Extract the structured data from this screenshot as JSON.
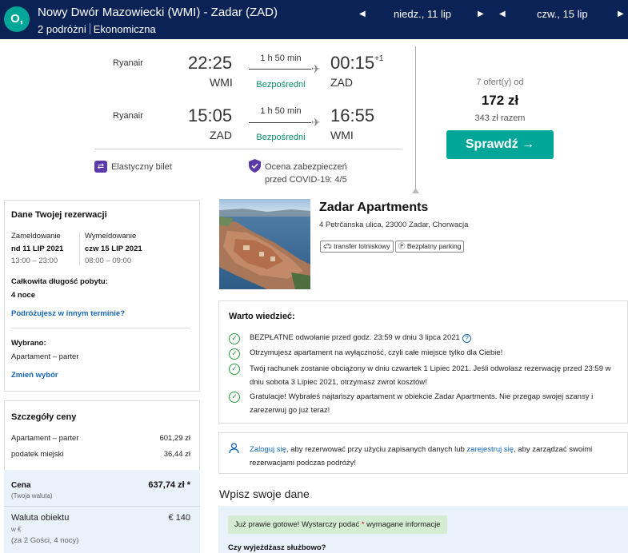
{
  "header": {
    "logo_char": "O,",
    "route": "Nowy Dwór Mazowiecki (WMI) - Zadar (ZAD)",
    "travelers": "2 podróżni",
    "cabin": "Ekonomiczna",
    "date_out": "niedz., 11 lip",
    "date_back": "czw., 15 lip"
  },
  "flights": [
    {
      "carrier": "Ryanair",
      "dep_time": "22:25",
      "dep_ap": "WMI",
      "duration": "1 h 50 min",
      "stops": "Bezpośredni",
      "arr_time": "00:15",
      "arr_extra": "+1",
      "arr_ap": "ZAD"
    },
    {
      "carrier": "Ryanair",
      "dep_time": "15:05",
      "dep_ap": "ZAD",
      "duration": "1 h 50 min",
      "stops": "Bezpośredni",
      "arr_time": "16:55",
      "arr_extra": "",
      "arr_ap": "WMI"
    }
  ],
  "features": {
    "flex": "Elastyczny bilet",
    "covid_1": "Ocena zabezpieczeń",
    "covid_2": "przed COVID-19: 4/5"
  },
  "deal": {
    "offers": "7 ofert(y) od",
    "price": "172 zł",
    "total": "343 zł razem",
    "button": "Sprawdź →"
  },
  "reservation": {
    "title": "Dane Twojej rezerwacji",
    "checkin_label": "Zameldowanie",
    "checkin_date": "nd 11 LIP 2021",
    "checkin_time": "13:00 – 23:00",
    "checkout_label": "Wymeldowanie",
    "checkout_date": "czw 15 LIP 2021",
    "checkout_time": "08:00 – 09:00",
    "stay_label": "Całkowita długość pobytu:",
    "stay_value": "4 noce",
    "change_dates": "Podróżujesz w innym terminie?",
    "selected_label": "Wybrano:",
    "selected_value": "Apartament – parter",
    "change_choice": "Zmień wybór"
  },
  "price_details": {
    "title": "Szczegóły ceny",
    "rows": [
      {
        "label": "Apartament – parter",
        "value": "601,29 zł"
      },
      {
        "label": "podatek miejski",
        "value": "36,44 zł"
      }
    ],
    "total_label": "Cena",
    "total_value": "637,74 zł *",
    "total_note": "(Twoja waluta)",
    "local_label": "Waluta obiektu",
    "local_value": "€ 140",
    "local_note": "w €",
    "guests_note": "(za 2 Gości,   4 nocy)"
  },
  "hotel": {
    "name": "Zadar Apartments",
    "address": "4 Petrčanska ulica, 23000 Zadar, Chorwacja",
    "tag1": "transfer lotniskowy",
    "tag2": "Bezpłatny parking"
  },
  "info": {
    "title": "Warto wiedzieć:",
    "item1": "BEZPŁATNE odwołanie przed godz. 23:59 w dniu 3 lipca 2021",
    "item2": "Otrzymujesz apartament na wyłączność, czyli całe miejsce tylko dla Ciebie!",
    "item3": "Twój rachunek zostanie obciążony w dniu czwartek 1 Lipiec 2021. Jeśli odwołasz rezerwację przed 23:59 w dniu sobota 3 Lipiec 2021, otrzymasz zwrot kosztów!",
    "item4": "Gratulacje! Wybrałeś najtańszy apartament w obiekcie Zadar Apartments. Nie przegap swojej szansy i zarezerwuj go już teraz!"
  },
  "login": {
    "login_link": "Zaloguj się",
    "text1": ", aby rezerwować przy użyciu zapisanych danych lub ",
    "register_link": "zarejestruj się",
    "text2": ", aby zarządzać swoimi rezerwacjami podczas podróży!"
  },
  "form": {
    "title": "Wpisz swoje dane",
    "notice_a": "Już prawie gotowe! Wystarczy podać ",
    "notice_star": "*",
    "notice_b": " wymagane informacje",
    "question": "Czy wyjeżdżasz służbowo?"
  },
  "colors": {
    "header_bg": "#0a2256",
    "accent": "#00a698",
    "link": "#1565b8",
    "success": "#2a9a3c"
  }
}
